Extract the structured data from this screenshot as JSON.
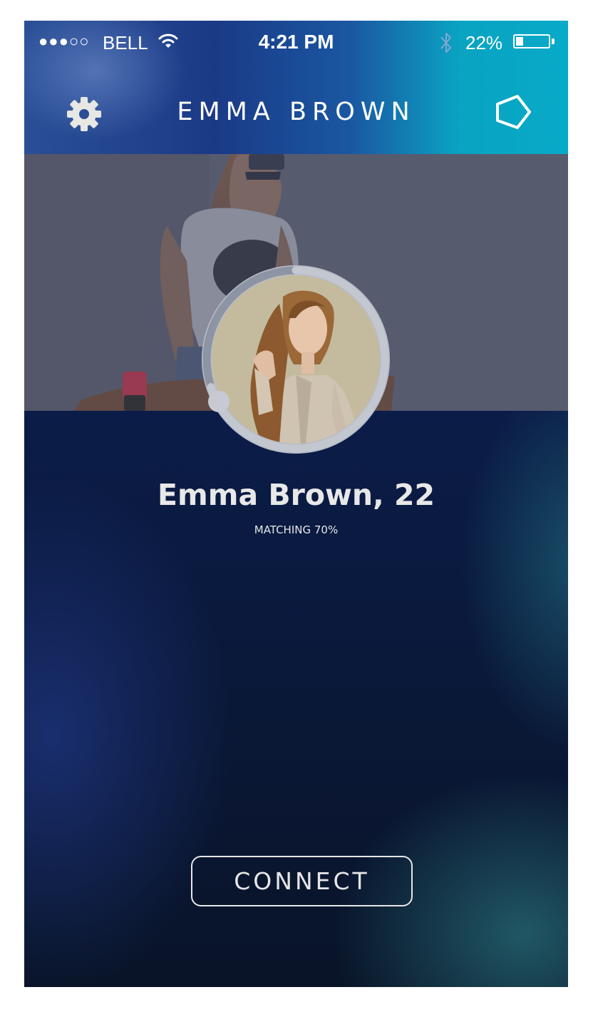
{
  "status_bar": {
    "signal": "●●●○○",
    "carrier": "BELL",
    "time": "4:21 PM",
    "battery_percent": "22%",
    "battery_level": 0.22
  },
  "header": {
    "title": "EMMA BROWN",
    "settings_icon": "gear-icon",
    "menu_icon": "pentagon-icon"
  },
  "profile": {
    "name": "Emma Brown, 22",
    "matching": "MATCHING 70%",
    "match_fraction": 0.7
  },
  "actions": {
    "connect_label": "CONNECT"
  },
  "colors": {
    "header_left": "#2a4f97",
    "header_right": "#07aac8",
    "background": "#0b1d4b",
    "text": "#e8e8e8"
  }
}
